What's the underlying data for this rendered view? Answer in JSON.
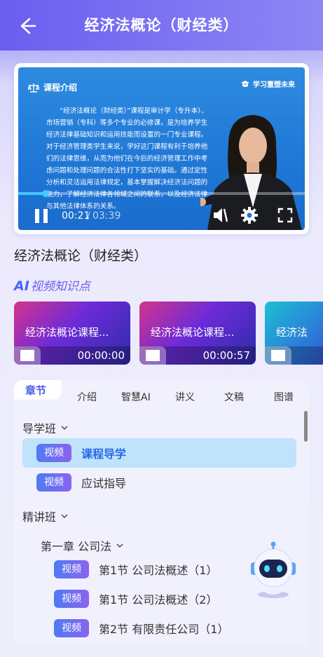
{
  "header": {
    "title": "经济法概论（财经类）"
  },
  "video": {
    "course_tag": "课程介绍",
    "brand": "学习重塑未来",
    "intro_text": "“经济法概论（财经类）”课程是审计学（专升本）、市场营销（专科）等多个专业的必修课，是为培养学生经济法律基础知识和运用技能而设置的一门专业课程。对于经济管理类学生来说，学好这门课程有利于培养他们的法律思维，从而为他们在今后的经济管理工作中考虑问题和处理问题的合法性打下坚实的基础。通过定性分析和灵活运用法律规定，基本掌握解决经济法问题的能力，了解经济法律各领域之间的联系，以及经济法律与其他法律体系的关系。",
    "time_current": "00:21",
    "time_separator": "/",
    "time_total": "03:39",
    "progress": 0.096
  },
  "course_title": "经济法概论（财经类）",
  "ai_section": {
    "mark": "AI",
    "label": "视频知识点"
  },
  "knowledge_points": [
    {
      "title": "经济法概论课程...",
      "time": "00:00:00"
    },
    {
      "title": "经济法概论课程...",
      "time": "00:00:57"
    },
    {
      "title": "经济法",
      "time": ""
    }
  ],
  "tabs": [
    {
      "label": "章节",
      "active": true
    },
    {
      "label": "介绍"
    },
    {
      "label": "智慧AI"
    },
    {
      "label": "讲义"
    },
    {
      "label": "文稿"
    },
    {
      "label": "图谱"
    }
  ],
  "tree": {
    "group1": {
      "label": "导学班"
    },
    "group1_items": [
      {
        "badge": "视频",
        "label": "课程导学",
        "selected": true
      },
      {
        "badge": "视频",
        "label": "应试指导"
      }
    ],
    "group2": {
      "label": "精讲班"
    },
    "chapter1": {
      "label": "第一章 公司法"
    },
    "chapter1_items": [
      {
        "badge": "视频",
        "label": "第1节 公司法概述（1）"
      },
      {
        "badge": "视频",
        "label": "第1节 公司法概述（2）"
      },
      {
        "badge": "视频",
        "label": "第2节 有限责任公司（1）"
      }
    ]
  },
  "colors": {
    "accent": "#6a5ef0",
    "selected_row": "#bfe3fb",
    "active_tab": "#4e5cf0"
  }
}
